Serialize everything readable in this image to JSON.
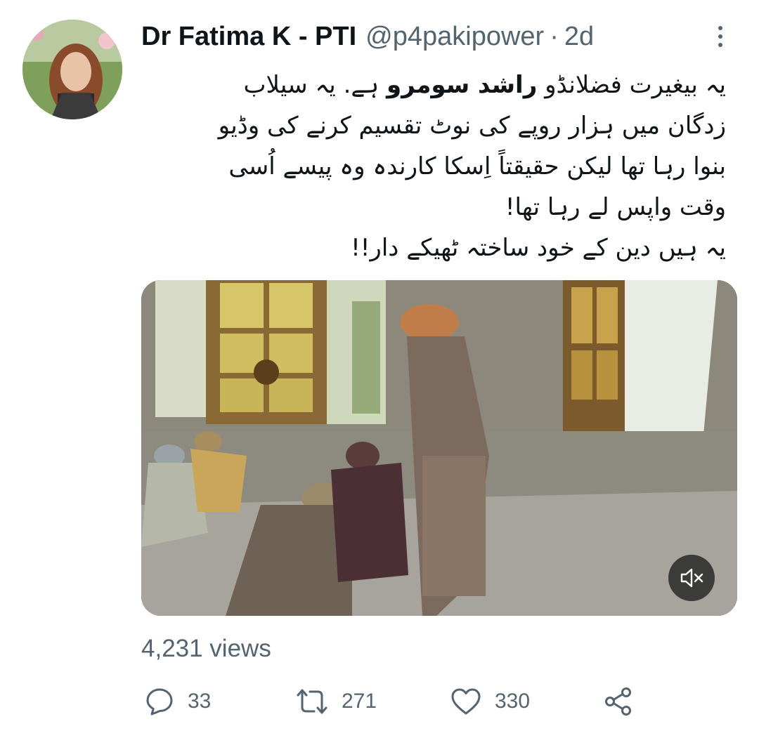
{
  "tweet": {
    "author_name": "Dr Fatima K - PTI",
    "handle": "@p4pakipower",
    "separator": "·",
    "age": "2d",
    "text_lines": {
      "l1_start": "یہ بیغیرت فضلانڈو",
      "l1_bold": "راشد سومرو",
      "l1_end": "ہے. یہ سیلاب",
      "l2": "زدگان میں ہزار روپے کی نوٹ تقسیم کرنے کی وڈیو",
      "l3": "بنوا رہا تھا لیکن حقیقتاً اِسکا کارندہ وہ پیسے اُسی",
      "l4": "وقت واپس لے رہا تھا!",
      "l5": "یہ ہیں دین کے خود ساختہ ٹھیکے دار!!"
    },
    "views": "4,231 views"
  },
  "actions": {
    "replies": "33",
    "retweets": "271",
    "likes": "330"
  },
  "icons": {
    "more": "more-vertical-icon",
    "mute": "volume-muted-icon",
    "reply": "comment-icon",
    "retweet": "retweet-icon",
    "like": "heart-icon",
    "share": "share-icon"
  },
  "colors": {
    "text": "#0f1419",
    "secondary": "#536471",
    "background": "#ffffff"
  }
}
